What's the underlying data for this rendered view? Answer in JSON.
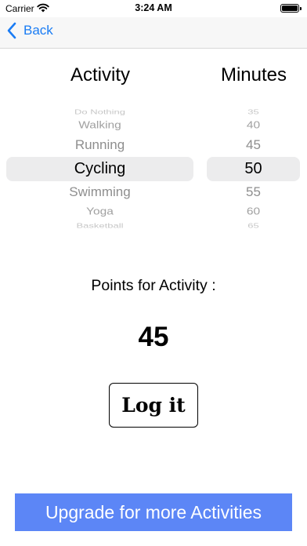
{
  "status_bar": {
    "carrier": "Carrier",
    "time": "3:24 AM"
  },
  "nav": {
    "back_label": "Back"
  },
  "headers": {
    "activity": "Activity",
    "minutes": "Minutes"
  },
  "activity_picker": {
    "items": [
      "Do Nothing",
      "Walking",
      "Running",
      "Cycling",
      "Swimming",
      "Yoga",
      "Basketball"
    ],
    "selected": "Cycling"
  },
  "minutes_picker": {
    "items": [
      "35",
      "40",
      "45",
      "50",
      "55",
      "60",
      "65"
    ],
    "selected": "50"
  },
  "points": {
    "label": "Points for Activity :",
    "value": "45"
  },
  "log_button": {
    "label": "Log it"
  },
  "upgrade_button": {
    "label": "Upgrade for more Activities"
  },
  "colors": {
    "accent": "#1a7cf4",
    "upgrade_bg": "#5c86f6",
    "selection_band": "#ececed"
  }
}
